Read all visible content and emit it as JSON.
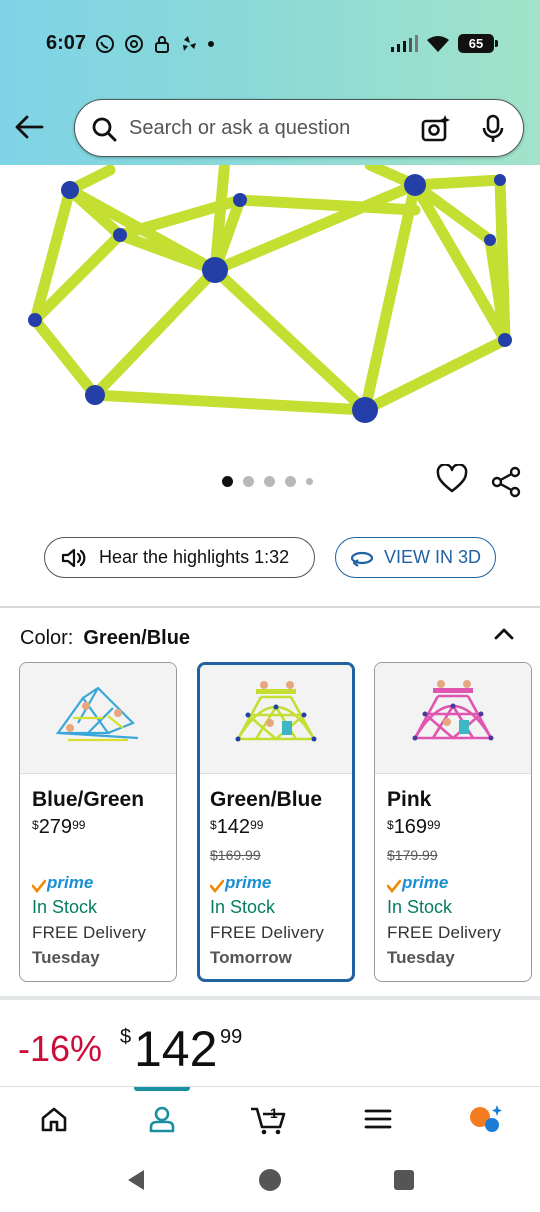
{
  "status_bar": {
    "time": "6:07",
    "battery": "65"
  },
  "header": {
    "search_placeholder": "Search or ask a question",
    "icons": [
      "back-arrow-icon",
      "search-icon",
      "camera-sparkle-icon",
      "mic-icon"
    ]
  },
  "gallery": {
    "total_images": 5,
    "active_index": 0
  },
  "actions": {
    "hear_label": "Hear the highlights 1:32",
    "view3d_label": "VIEW IN 3D"
  },
  "color_selector": {
    "label": "Color:",
    "selected": "Green/Blue",
    "variants": [
      {
        "name": "Blue/Green",
        "price_symbol": "$",
        "price_whole": "279",
        "price_fraction": "99",
        "list_price": "",
        "prime": "prime",
        "stock": "In Stock",
        "delivery": "FREE Delivery",
        "day": "Tuesday",
        "selected": false
      },
      {
        "name": "Green/Blue",
        "price_symbol": "$",
        "price_whole": "142",
        "price_fraction": "99",
        "list_price": "$169.99",
        "prime": "prime",
        "stock": "In Stock",
        "delivery": "FREE Delivery",
        "day": "Tomorrow",
        "selected": true
      },
      {
        "name": "Pink",
        "price_symbol": "$",
        "price_whole": "169",
        "price_fraction": "99",
        "list_price": "$179.99",
        "prime": "prime",
        "stock": "In Stock",
        "delivery": "FREE Delivery",
        "day": "Tuesday",
        "selected": false
      }
    ]
  },
  "price": {
    "discount": "-16%",
    "symbol": "$",
    "whole": "142",
    "fraction": "99"
  },
  "bottom_nav": {
    "items": [
      "home-icon",
      "account-icon",
      "cart-icon",
      "menu-icon",
      "rufus-icon"
    ],
    "active": "account-icon",
    "cart_count": "1"
  },
  "colors": {
    "accent_blue": "#2162a1",
    "discount_red": "#cc0c39",
    "stock_green": "#067d62",
    "frame_green": "#c9e33a",
    "joint_blue": "#1f3fa6"
  }
}
